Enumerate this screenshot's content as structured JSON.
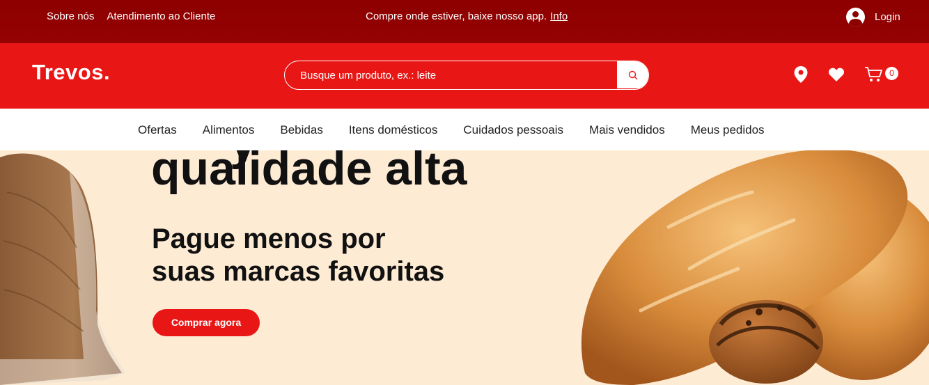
{
  "topbar": {
    "about": "Sobre nós",
    "support": "Atendimento ao Cliente",
    "promo": "Compre onde estiver, baixe nosso app.",
    "promo_link": "Info",
    "login": "Login"
  },
  "header": {
    "logo": "Trevos.",
    "search_placeholder": "Busque um produto, ex.: leite",
    "cart_count": "0",
    "icons": [
      "location-icon",
      "heart-icon",
      "cart-icon",
      "search-icon"
    ]
  },
  "nav": {
    "items": [
      "Ofertas",
      "Alimentos",
      "Bebidas",
      "Itens domésticos",
      "Cuidados pessoais",
      "Mais vendidos",
      "Meus pedidos"
    ]
  },
  "hero": {
    "headline_line1_partial": "y",
    "headline": "qualidade alta",
    "subheadline_1": "Pague menos por",
    "subheadline_2": "suas marcas favoritas",
    "cta": "Comprar agora"
  },
  "colors": {
    "topbar": "#8d0000",
    "header": "#e91616",
    "hero_bg": "#fdebd3",
    "text": "#111111"
  }
}
